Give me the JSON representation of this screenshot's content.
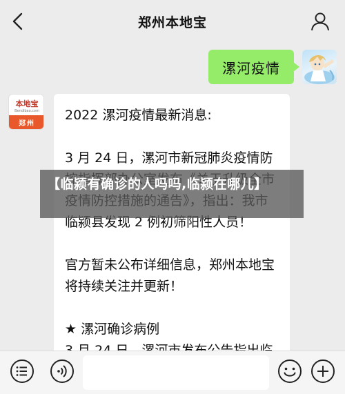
{
  "header": {
    "title": "郑州本地宝",
    "back_icon": "chevron-left-icon",
    "profile_icon": "person-icon"
  },
  "messages": {
    "outgoing": {
      "text": "漯河疫情"
    },
    "incoming": {
      "sender_logo_top": "本地宝",
      "sender_logo_sub": "Bendibao.com",
      "sender_logo_bottom": "郑州",
      "paragraphs": [
        "2022 漯河疫情最新消息:",
        "3 月 24 日，漯河市新冠肺炎疫情防控指挥部办公室发布《关于升级全市疫情防控措施的通告》，指出：我市临颍县发现 2 例初筛阳性人员！",
        "官方暂未公布详细信息，郑州本地宝将持续关注并更新！",
        "★ 漯河确诊病例",
        "3 月 24 日，漯河市发布公告指出临"
      ]
    }
  },
  "overlay": {
    "headline": "【临颍有确诊的人吗吗,临颍在哪儿】"
  },
  "bottom_bar": {
    "menu_icon": "menu-icon",
    "voice_icon": "voice-icon",
    "emoji_icon": "emoji-icon",
    "add_icon": "add-icon"
  },
  "colors": {
    "background": "#ececec",
    "bubble_green": "#95ec69",
    "bubble_white": "#ffffff",
    "brand_orange": "#e8582a",
    "overlay": "#585858"
  }
}
